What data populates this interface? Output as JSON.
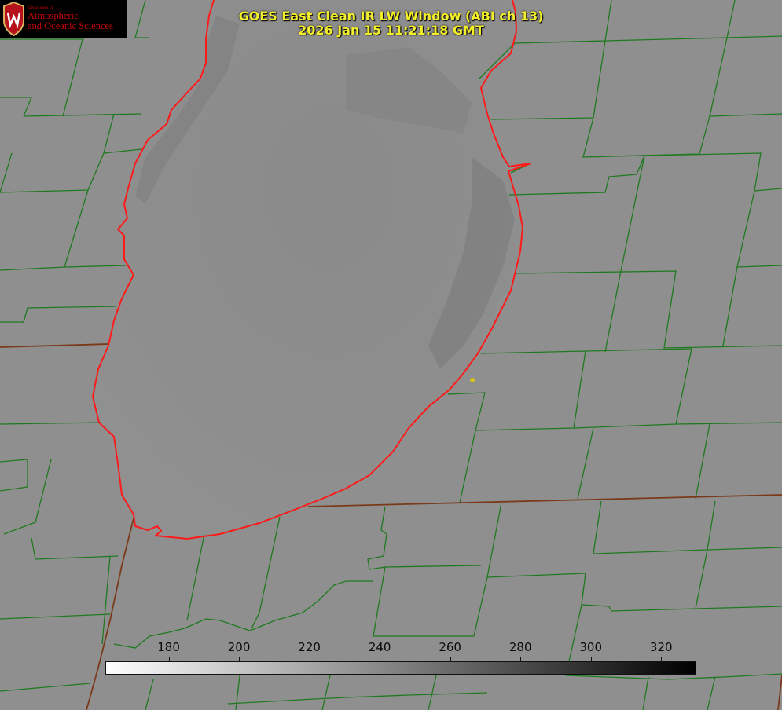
{
  "title": {
    "line1": "GOES East Clean IR LW Window (ABI ch 13)",
    "line2": "2026 Jan 15 11:21:18 GMT"
  },
  "logo": {
    "department": "Department of",
    "org_line1": "Atmospheric",
    "org_line2": "and Oceanic Sciences"
  },
  "colorbar": {
    "min": 162,
    "max": 330,
    "ticks": [
      "180",
      "200",
      "220",
      "240",
      "260",
      "280",
      "300",
      "320"
    ],
    "color_low": "#ffffff",
    "color_high": "#000000"
  },
  "colors": {
    "land": "#8e8e8e",
    "lake": "#888888",
    "county_lines": "#1f7a1f",
    "state_lines": "#8a3a1a",
    "shoreline": "#ff1a1a",
    "title_text": "#f2ee2a",
    "marker": "#d4c21a"
  }
}
